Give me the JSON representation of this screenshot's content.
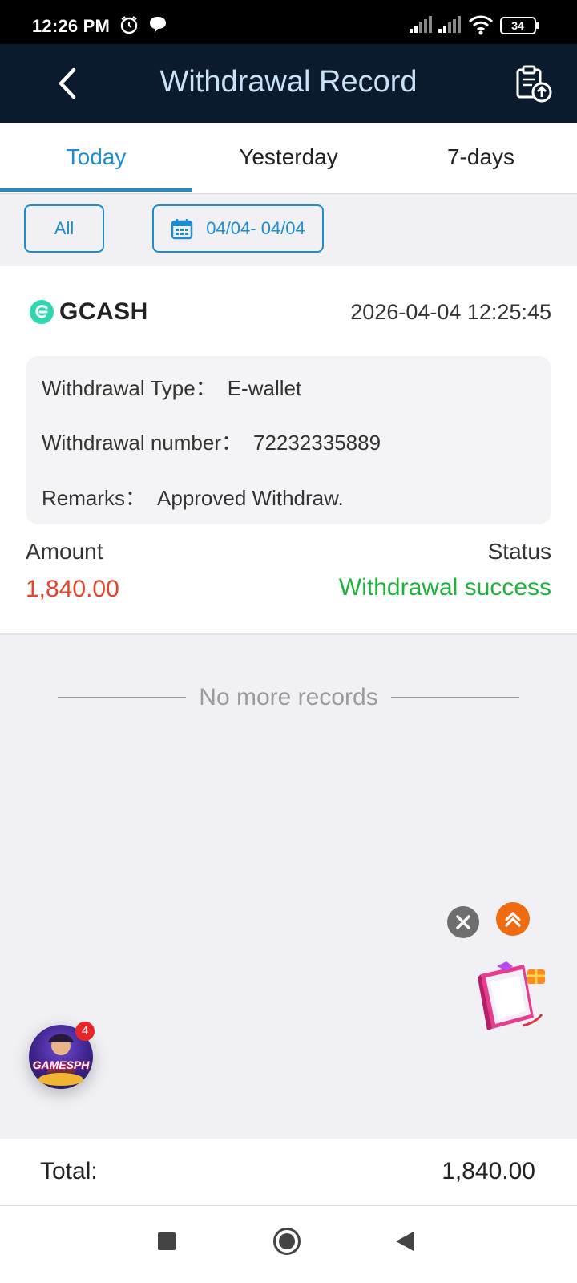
{
  "status_bar": {
    "time": "12:26 PM",
    "battery": "34"
  },
  "header": {
    "title": "Withdrawal Record"
  },
  "tabs": [
    {
      "label": "Today",
      "active": true
    },
    {
      "label": "Yesterday",
      "active": false
    },
    {
      "label": "7-days",
      "active": false
    }
  ],
  "filters": {
    "all_label": "All",
    "date_range": "04/04- 04/04"
  },
  "record": {
    "brand": "GCASH",
    "datetime": "2026-04-04 12:25:45",
    "type_label": "Withdrawal Type：",
    "type_value": "E-wallet",
    "number_label": "Withdrawal number：",
    "number_value": "72232335889",
    "remarks_label": "Remarks：",
    "remarks_value": "Approved Withdraw.",
    "amount_label": "Amount",
    "amount_value": "1,840.00",
    "status_label": "Status",
    "status_value": "Withdrawal success"
  },
  "list_end_text": "No more records",
  "floating": {
    "game_text": "GAMESPH",
    "badge_count": "4"
  },
  "footer": {
    "total_label": "Total:",
    "total_value": "1,840.00"
  },
  "colors": {
    "accent": "#1d8cd0",
    "amount": "#e5432b",
    "success": "#1fb23d",
    "header_bg": "#0b1a2c"
  }
}
